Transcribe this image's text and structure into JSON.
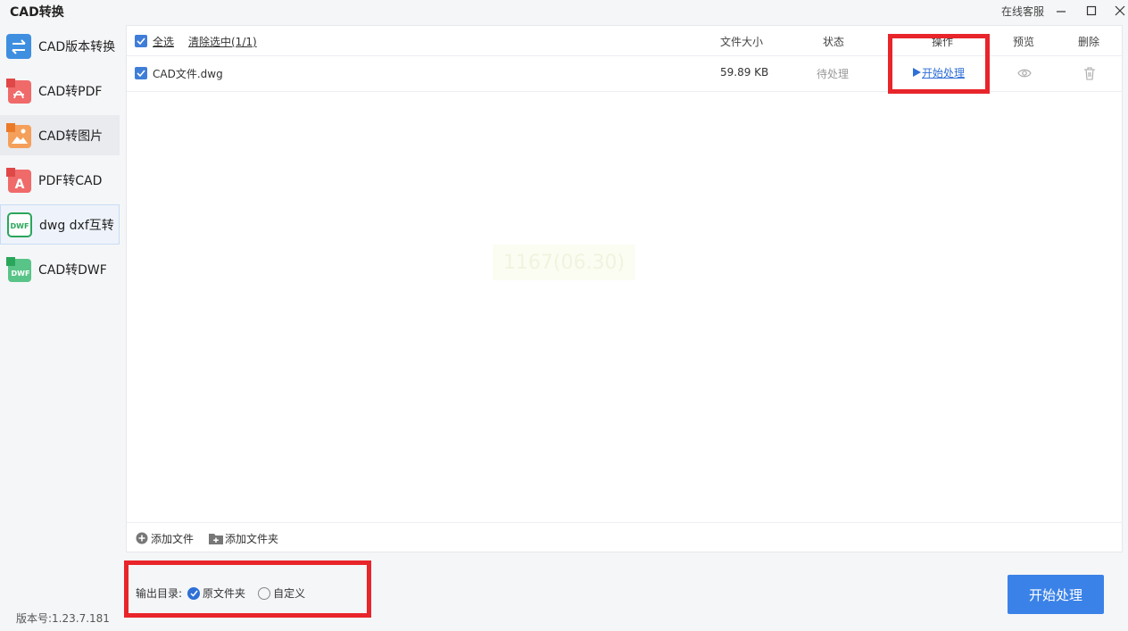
{
  "window": {
    "title": "CAD转换",
    "service_label": "在线客服"
  },
  "sidebar": {
    "items": [
      {
        "label": "CAD版本转换",
        "icon": "version-convert-icon",
        "color": "#3f8fe0"
      },
      {
        "label": "CAD转PDF",
        "icon": "pdf-icon",
        "color": "#e85a5a"
      },
      {
        "label": "CAD转图片",
        "icon": "image-icon",
        "color": "#f08a3a"
      },
      {
        "label": "PDF转CAD",
        "icon": "pdf-to-cad-icon",
        "color": "#e85a5a"
      },
      {
        "label": "dwg dxf互转",
        "icon": "dwf-swap-icon",
        "color": "#2aa65a"
      },
      {
        "label": "CAD转DWF",
        "icon": "dwf-icon",
        "color": "#2aa65a"
      }
    ],
    "version": "版本号:1.23.7.181"
  },
  "table": {
    "select_all": "全选",
    "clear_selected": "清除选中(1/1)",
    "headers": {
      "size": "文件大小",
      "status": "状态",
      "action": "操作",
      "preview": "预览",
      "delete": "删除"
    },
    "rows": [
      {
        "name": "CAD文件.dwg",
        "size": "59.89 KB",
        "status": "待处理",
        "action": "开始处理"
      }
    ],
    "watermark": "1167(06.30)"
  },
  "toolbar": {
    "add_file": "添加文件",
    "add_folder": "添加文件夹"
  },
  "output": {
    "label": "输出目录:",
    "options": [
      "原文件夹",
      "自定义"
    ],
    "selected": "原文件夹"
  },
  "start_button": "开始处理",
  "colors": {
    "accent": "#3b82e8",
    "highlight": "#e8252a"
  }
}
